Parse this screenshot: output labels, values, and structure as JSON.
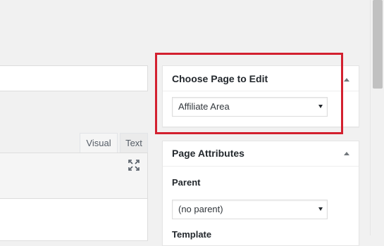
{
  "editor": {
    "tabs": [
      {
        "label": "Visual"
      },
      {
        "label": "Text"
      }
    ]
  },
  "choose_page": {
    "title": "Choose Page to Edit",
    "selected": "Affiliate Area"
  },
  "page_attributes": {
    "title": "Page Attributes",
    "parent_label": "Parent",
    "parent_selected": "(no parent)",
    "template_label": "Template"
  },
  "colors": {
    "highlight": "#d3202f",
    "background": "#f1f1f1"
  }
}
